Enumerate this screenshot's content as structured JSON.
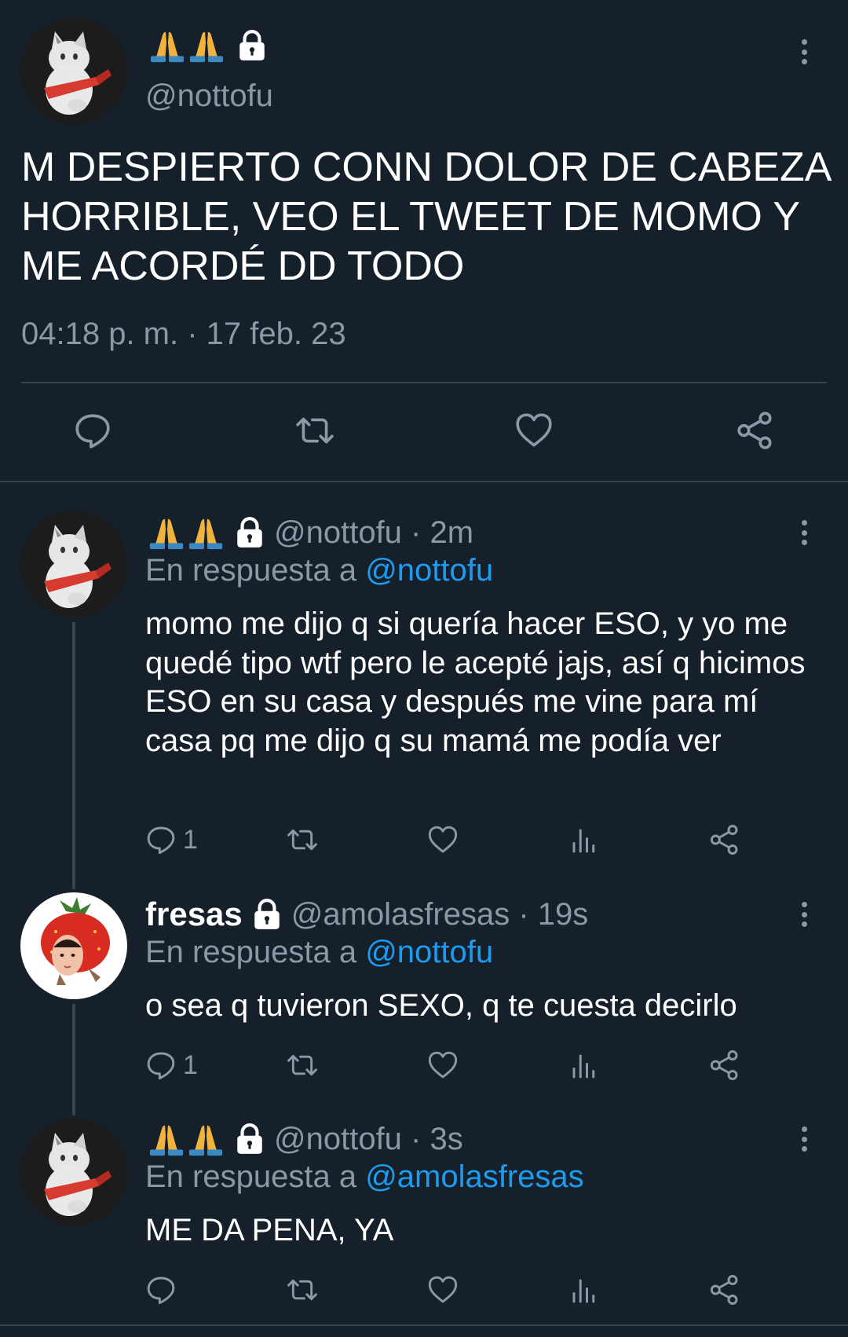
{
  "main_tweet": {
    "display_name_icons": [
      "folded-hands-emoji",
      "folded-hands-emoji",
      "lock-icon"
    ],
    "handle": "@nottofu",
    "text": "M DESPIERTO CONN DOLOR DE CABEZA HORRIBLE, VEO EL TWEET DE MOMO Y ME ACORDÉ DD TODO",
    "timestamp": "04:18 p. m. · 17 feb. 23",
    "actions": [
      "reply",
      "retweet",
      "like",
      "share"
    ]
  },
  "replies": [
    {
      "display_name": "",
      "name_icons": [
        "folded-hands-emoji",
        "folded-hands-emoji",
        "lock-icon"
      ],
      "handle_time": "@nottofu · 2m",
      "reply_prefix": "En respuesta a",
      "reply_mention": "@nottofu",
      "text": "momo me dijo q si quería hacer ESO, y yo me quedé tipo wtf pero le acepté jajs, así q hicimos ESO en su casa y después me vine para mí casa pq me dijo q su mamá me podía ver",
      "reply_count": "1"
    },
    {
      "display_name": "fresas",
      "name_icons": [
        "lock-icon"
      ],
      "handle_time": "@amolasfresas · 19s",
      "reply_prefix": "En respuesta a",
      "reply_mention": "@nottofu",
      "text": "o sea q tuvieron SEXO, q te cuesta decirlo",
      "reply_count": "1"
    },
    {
      "display_name": "",
      "name_icons": [
        "folded-hands-emoji",
        "folded-hands-emoji",
        "lock-icon"
      ],
      "handle_time": "@nottofu · 3s",
      "reply_prefix": "En respuesta a",
      "reply_mention": "@amolasfresas",
      "text": "ME DA PENA, YA",
      "reply_count": ""
    }
  ],
  "colors": {
    "background": "#15202b",
    "secondary_text": "#8b98a5",
    "link": "#1d9bf0",
    "divider": "#38444d"
  }
}
